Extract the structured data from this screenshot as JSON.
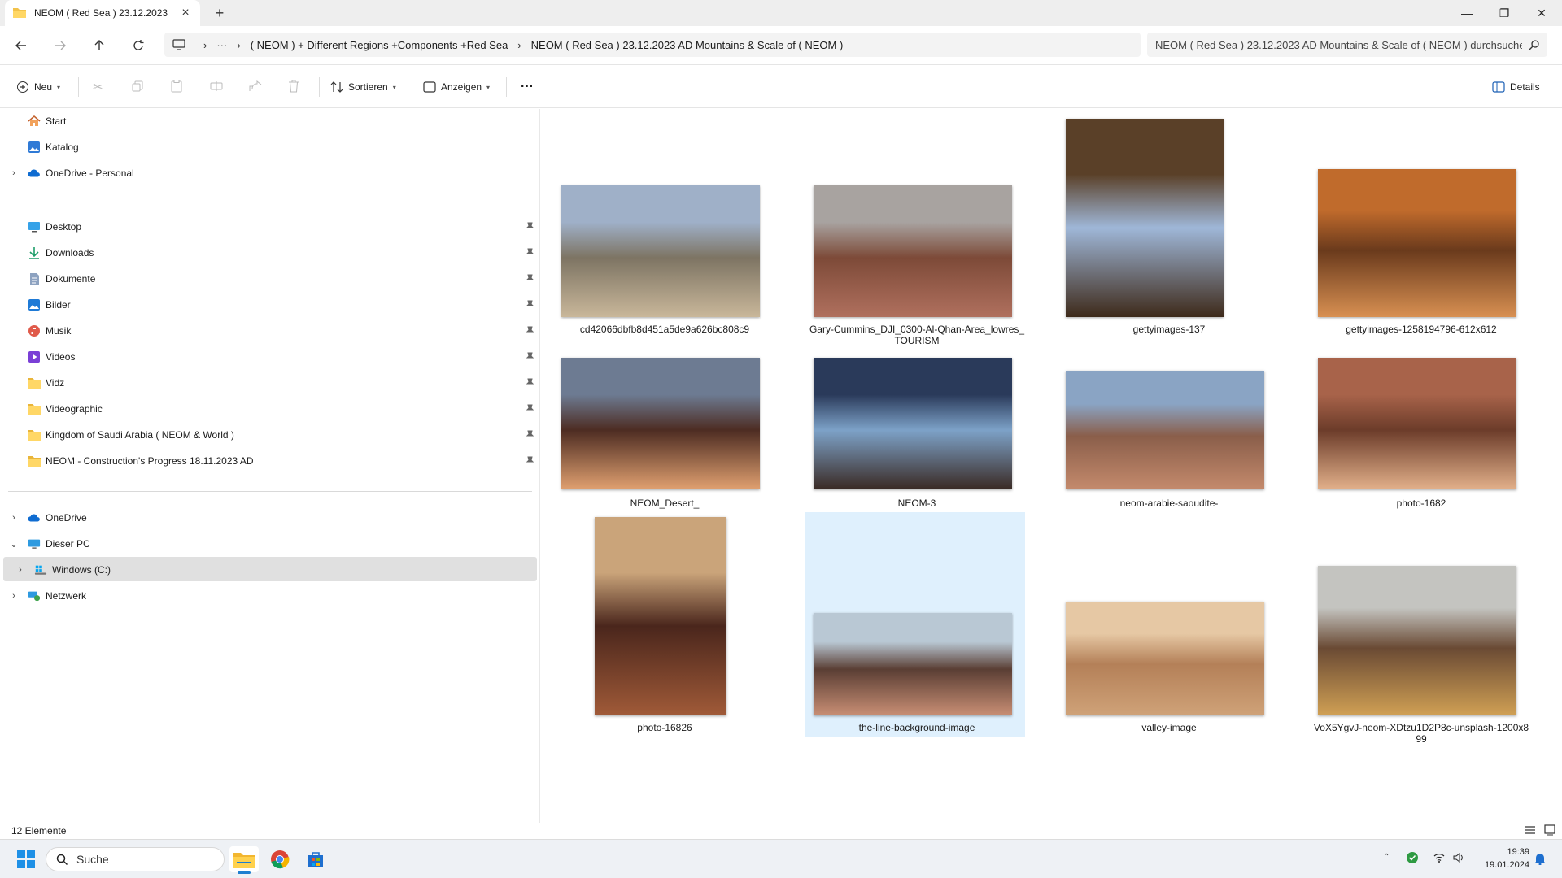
{
  "window": {
    "tab_title": "NEOM ( Red Sea )  23.12.2023",
    "new_tab": "+",
    "close_tab": "×",
    "minimize": "—",
    "maximize": "❐",
    "close": "✕"
  },
  "address": {
    "ellipsis": "···",
    "crumbs": [
      "( NEOM ) + Different Regions +Components +Red Sea",
      "NEOM ( Red Sea )  23.12.2023 AD Mountains & Scale of ( NEOM )"
    ],
    "search_text": "NEOM ( Red Sea )  23.12.2023 AD Mountains & Scale of ( NEOM ) durchsuchen"
  },
  "toolbar": {
    "new_label": "Neu",
    "sort_label": "Sortieren",
    "view_label": "Anzeigen",
    "more": "···",
    "details_label": "Details"
  },
  "sidebar": {
    "top": [
      {
        "label": "Start",
        "icon": "home-icon"
      },
      {
        "label": "Katalog",
        "icon": "gallery-icon"
      },
      {
        "label": "OneDrive - Personal",
        "icon": "cloud-icon"
      }
    ],
    "quick": [
      {
        "label": "Desktop",
        "icon": "desktop-icon"
      },
      {
        "label": "Downloads",
        "icon": "download-icon"
      },
      {
        "label": "Dokumente",
        "icon": "document-icon"
      },
      {
        "label": "Bilder",
        "icon": "pictures-icon"
      },
      {
        "label": "Musik",
        "icon": "music-icon"
      },
      {
        "label": "Videos",
        "icon": "videos-icon"
      },
      {
        "label": "Vidz",
        "icon": "folder-icon"
      },
      {
        "label": "Videographic",
        "icon": "folder-icon"
      },
      {
        "label": "Kingdom of Saudi Arabia ( NEOM & World  )",
        "icon": "folder-icon"
      },
      {
        "label": "NEOM - Construction's Progress 18.11.2023 AD",
        "icon": "folder-icon"
      }
    ],
    "bottom": [
      {
        "label": "OneDrive",
        "icon": "cloud-icon"
      },
      {
        "label": "Dieser PC",
        "icon": "pc-icon"
      },
      {
        "label": "Windows (C:)",
        "icon": "drive-icon"
      },
      {
        "label": "Netzwerk",
        "icon": "network-icon"
      }
    ]
  },
  "files": [
    {
      "name": "cd42066dbfb8d451a5de9a626bc808c9",
      "colors": [
        "#9fb0c8",
        "#7d7463",
        "#c9b79a"
      ]
    },
    {
      "name": "Gary-Cummins_DJI_0300-Al-Qhan-Area_lowres_TOURISM",
      "colors": [
        "#a8a3a0",
        "#7d4a38",
        "#b0705e"
      ]
    },
    {
      "name": "gettyimages-137",
      "colors": [
        "#5a4028",
        "#9fb7d8",
        "#3e2a1a"
      ]
    },
    {
      "name": "gettyimages-1258194796-612x612",
      "colors": [
        "#c06b2c",
        "#6a3a1c",
        "#d89052"
      ]
    },
    {
      "name": "NEOM_Desert_",
      "colors": [
        "#6d7b92",
        "#4d2c22",
        "#e0a070"
      ]
    },
    {
      "name": "NEOM-3",
      "colors": [
        "#2a3a5a",
        "#7da2c8",
        "#3a2a24"
      ]
    },
    {
      "name": "neom-arabie-saoudite-",
      "colors": [
        "#8aa4c4",
        "#8a5e4a",
        "#c48a6c"
      ]
    },
    {
      "name": "photo-1682",
      "colors": [
        "#a8634a",
        "#6c3c2a",
        "#e2b08a"
      ]
    },
    {
      "name": "photo-16826",
      "colors": [
        "#caa47a",
        "#4a261c",
        "#a05a38"
      ]
    },
    {
      "name": "the-line-background-image",
      "colors": [
        "#b9c8d4",
        "#5a3e34",
        "#c88e74"
      ]
    },
    {
      "name": "valley-image",
      "colors": [
        "#e6c8a4",
        "#b48058",
        "#cfa278"
      ]
    },
    {
      "name": "VoX5YgvJ-neom-XDtzu1D2P8c-unsplash-1200x899",
      "colors": [
        "#c4c4c0",
        "#6a4a34",
        "#d0a054"
      ]
    }
  ],
  "status": {
    "count": "12 Elemente"
  },
  "taskbar": {
    "search_placeholder": "Suche",
    "time": "19:39",
    "date": "19.01.2024"
  }
}
